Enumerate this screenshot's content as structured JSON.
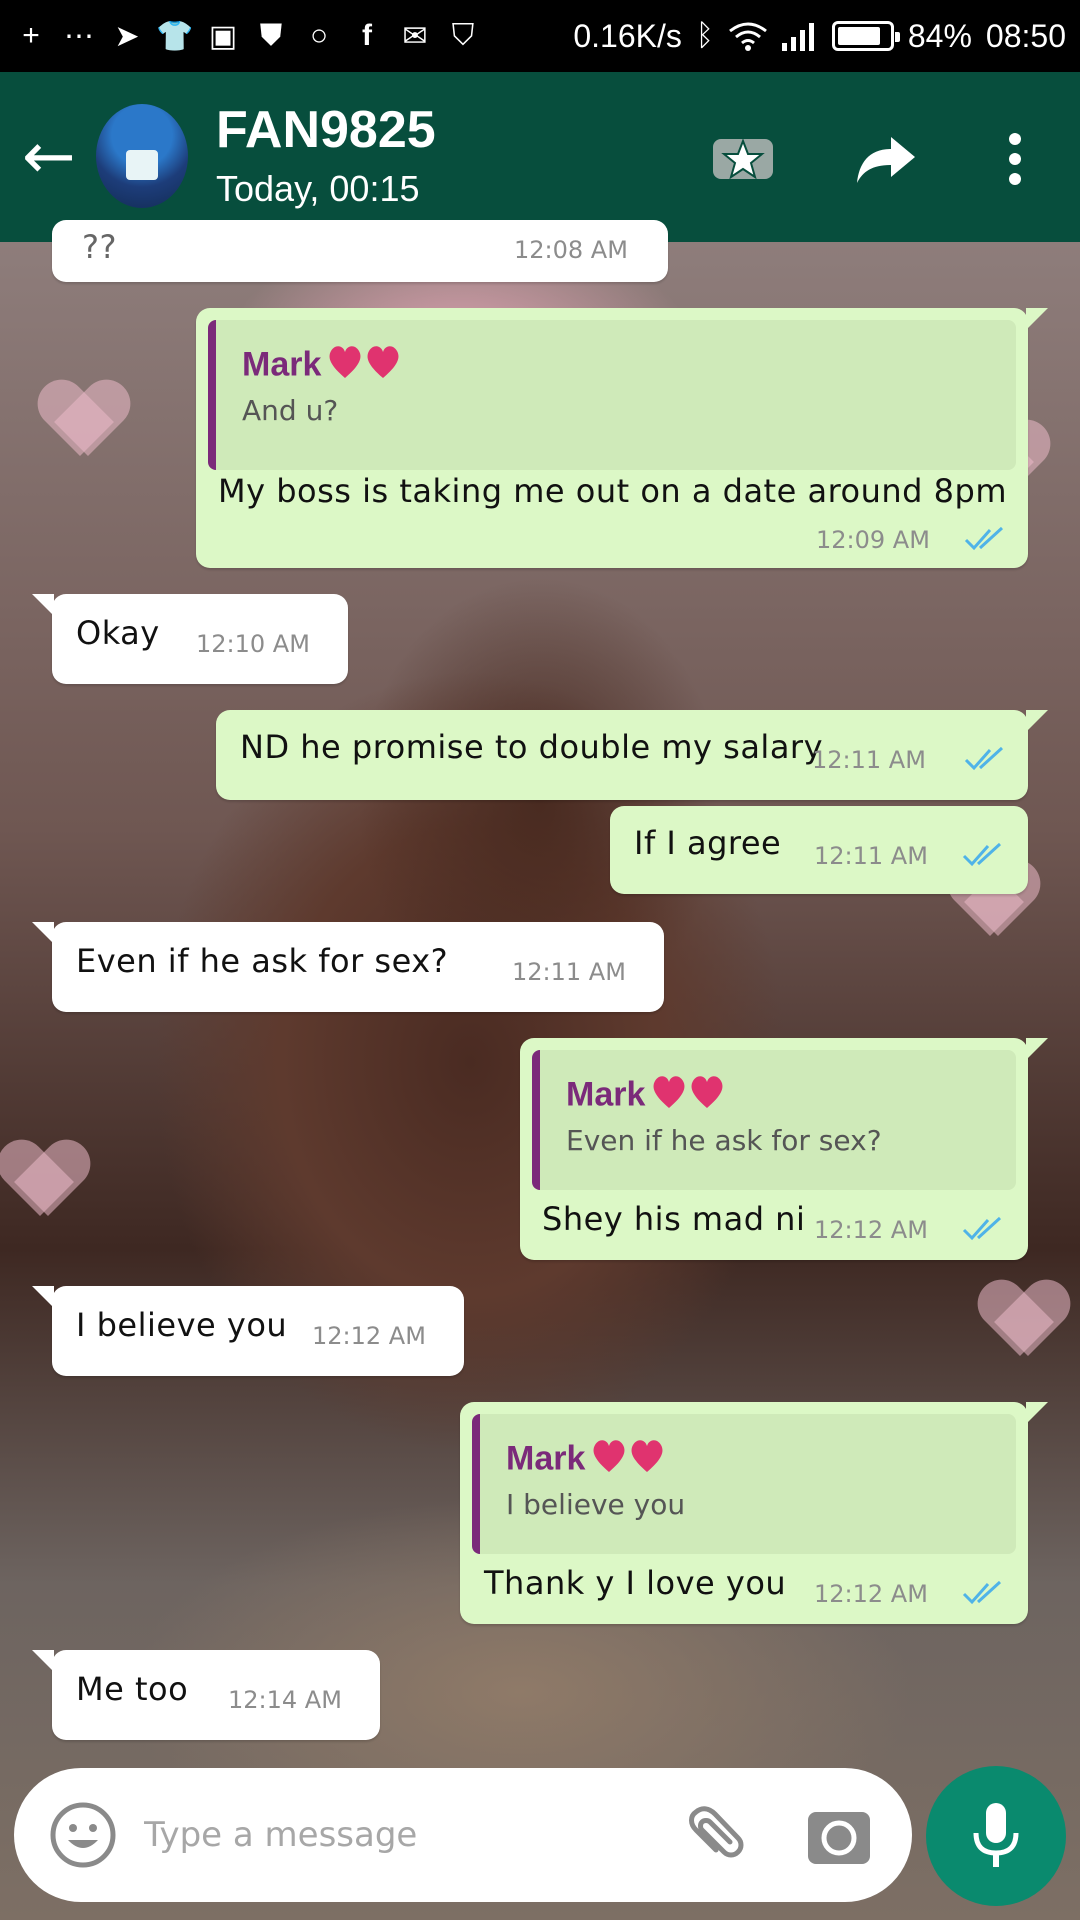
{
  "status_bar": {
    "left_icons": [
      "plus-icon",
      "more-dots-icon",
      "telegram-icon",
      "shirt-icon",
      "gallery-icon",
      "shield-icon",
      "chat-icon",
      "facebook-icon",
      "gmail-icon",
      "shield-outline-icon"
    ],
    "network_speed": "0.16K/s",
    "battery_percent": "84%",
    "battery_level": 0.84,
    "time": "08:50"
  },
  "header": {
    "contact_name": "FAN9825",
    "last_seen": "Today, 00:15",
    "background_color": "#074e3d"
  },
  "messages": [
    {
      "direction": "in",
      "text": "??",
      "time": "12:08 AM"
    },
    {
      "direction": "out",
      "quoted_name": "Mark",
      "quoted_text": "And u?",
      "text": "My boss is taking me out on a date around 8pm",
      "time": "12:09 AM",
      "ticks": "read"
    },
    {
      "direction": "in",
      "text": "Okay",
      "time": "12:10 AM"
    },
    {
      "direction": "out",
      "text": "ND he promise to double my salary",
      "time": "12:11 AM",
      "ticks": "read"
    },
    {
      "direction": "out",
      "text": "If I agree",
      "time": "12:11 AM",
      "ticks": "read"
    },
    {
      "direction": "in",
      "text": "Even if he ask for sex?",
      "time": "12:11 AM"
    },
    {
      "direction": "out",
      "quoted_name": "Mark",
      "quoted_text": "Even if he ask for sex?",
      "text": "Shey his mad ni",
      "time": "12:12 AM",
      "ticks": "read"
    },
    {
      "direction": "in",
      "text": "I believe you",
      "time": "12:12 AM"
    },
    {
      "direction": "out",
      "quoted_name": "Mark",
      "quoted_text": "I believe you",
      "text": "Thank y I love you",
      "time": "12:12 AM",
      "ticks": "read"
    },
    {
      "direction": "in",
      "text": "Me too",
      "time": "12:14 AM"
    }
  ],
  "composer": {
    "placeholder": "Type a message"
  },
  "colors": {
    "outgoing_bubble": "#dcf8c6",
    "incoming_bubble": "#ffffff",
    "read_tick": "#4fb3e8",
    "quote_accent": "#7b2a7a",
    "mic_button": "#0a8a6e"
  }
}
